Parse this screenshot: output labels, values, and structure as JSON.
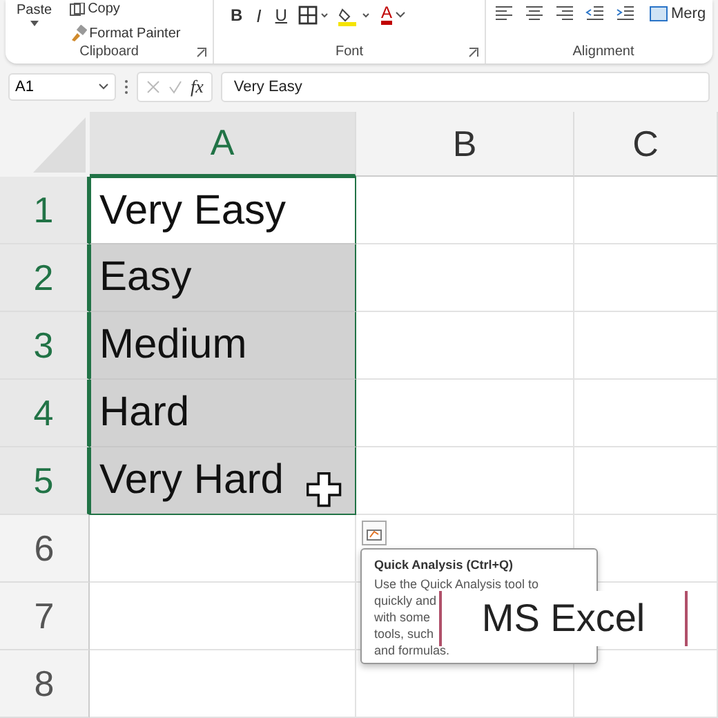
{
  "ribbon": {
    "clipboard": {
      "label": "Clipboard",
      "paste": "Paste",
      "copy": "Copy",
      "format_painter": "Format Painter"
    },
    "font": {
      "label": "Font",
      "buttons": [
        {
          "kind": "bold",
          "text": "B"
        },
        {
          "kind": "italic",
          "text": "I"
        },
        {
          "kind": "underline",
          "text": "U"
        },
        {
          "kind": "borders"
        },
        {
          "kind": "fill"
        },
        {
          "kind": "fontcolor",
          "text": "A"
        }
      ]
    },
    "alignment": {
      "label": "Alignment",
      "merge": "Merg"
    }
  },
  "formula_bar": {
    "name_box": "A1",
    "fx": "fx",
    "value": "Very Easy"
  },
  "columns": [
    {
      "label": "A",
      "selected": true
    },
    {
      "label": "B",
      "selected": false
    },
    {
      "label": "C",
      "selected": false
    }
  ],
  "rows": [
    {
      "number": "1",
      "selected": true,
      "value": "Very Easy",
      "active": true
    },
    {
      "number": "2",
      "selected": true,
      "value": "Easy",
      "active": false
    },
    {
      "number": "3",
      "selected": true,
      "value": "Medium",
      "active": false
    },
    {
      "number": "4",
      "selected": true,
      "value": "Hard",
      "active": false
    },
    {
      "number": "5",
      "selected": true,
      "value": "Very Hard",
      "active": false
    },
    {
      "number": "6",
      "selected": false
    },
    {
      "number": "7",
      "selected": false
    },
    {
      "number": "8",
      "selected": false
    }
  ],
  "tooltip": {
    "title": "Quick Analysis (Ctrl+Q)",
    "lines": [
      "Use the Quick Analysis tool to",
      "quickly and",
      "with some",
      "tools, such",
      "and formulas."
    ]
  },
  "caption": "MS Excel"
}
